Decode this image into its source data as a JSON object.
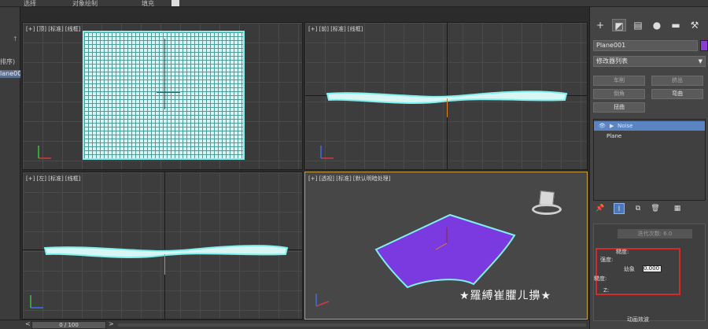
{
  "menubar": {
    "items": [
      "选择",
      "对象绘制",
      "填充"
    ]
  },
  "scene_explorer": {
    "sort_label": "排序)",
    "selected_item": "lane00",
    "arrow": "↑"
  },
  "viewports": {
    "top": {
      "label": "[+] [顶] [标准] [线框]"
    },
    "front": {
      "label": "[+] [前] [标准] [线框]"
    },
    "left": {
      "label": "[+] [左] [标准] [线框]"
    },
    "perspective": {
      "label": "[+] [透视] [标准] [默认明暗处理]"
    }
  },
  "command_panel": {
    "tabs": [
      "create-icon",
      "modify-icon",
      "hierarchy-icon",
      "motion-icon",
      "display-icon",
      "utilities-icon"
    ],
    "object_name": "Plane001",
    "object_color": "#8c3cd6",
    "modifier_list": "修改器列表",
    "buttons": [
      "车削",
      "挤出",
      "倒角",
      "弯曲",
      "扭曲"
    ],
    "stack": [
      "Noise",
      "Plane"
    ],
    "params": {
      "iterations_label": "迭代次数:",
      "iterations_value": "6.0",
      "roughness_label": "糙度:",
      "strength_label": "强度:",
      "scale_label": "幼象",
      "scale_value": "0.000",
      "strength2_label": "糙度:",
      "z_label": "Z:",
      "animate_label": "动画效波"
    }
  },
  "timeline": {
    "frame_display": "0 / 100",
    "prev": "<",
    "next": ">"
  },
  "overlay_text": "★羅縛崔臞ㄦ擤★",
  "colors": {
    "selection": "#7ff0ee",
    "plane": "#8c3cd6",
    "active_viewport": "#c7a13f",
    "stack_selected": "#5b84c4",
    "highlight_box": "#d42a2a"
  }
}
